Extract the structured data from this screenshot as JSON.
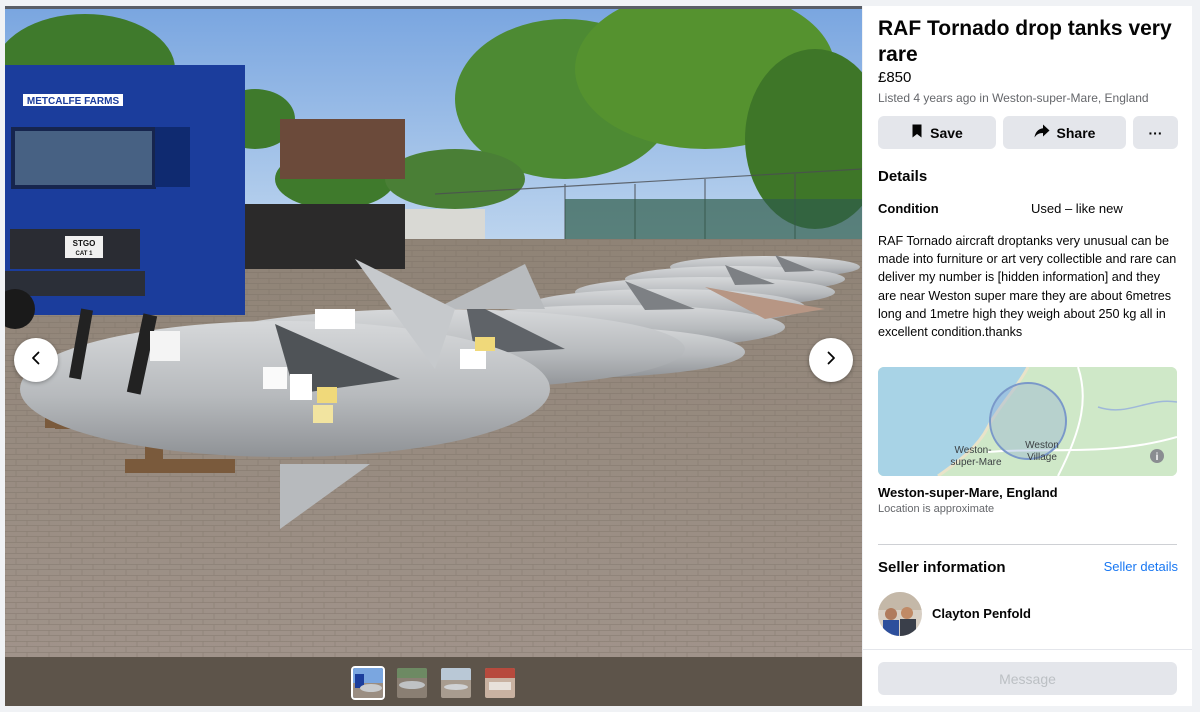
{
  "listing": {
    "title": "RAF Tornado drop tanks very rare",
    "price": "£850",
    "listed": "Listed 4 years ago in Weston-super-Mare, England"
  },
  "actions": {
    "save_label": "Save",
    "share_label": "Share",
    "more_label": "···"
  },
  "details": {
    "heading": "Details",
    "condition_label": "Condition",
    "condition_value": "Used – like new",
    "description": "RAF Tornado aircraft droptanks very unusual can be made into furniture or art very collectible and rare can deliver my number is [hidden information] and they are near Weston super mare they are about 6metres long and 1metre high they weigh about 250 kg all in excellent condition.thanks"
  },
  "map": {
    "label_1": "Weston-",
    "label_2": "super-Mare",
    "label_3": "Weston",
    "label_4": "Village",
    "info_icon": "info-icon"
  },
  "location": {
    "name": "Weston-super-Mare, England",
    "note": "Location is approximate"
  },
  "seller": {
    "heading": "Seller information",
    "details_link": "Seller details",
    "name": "Clayton Penfold"
  },
  "message_label": "Message",
  "photo": {
    "truck_sign": "METCALFE FARMS",
    "plate_1": "STGO",
    "plate_2": "CAT 1",
    "icons": {
      "prev": "chevron-left-icon",
      "next": "chevron-right-icon"
    }
  },
  "thumbnails_count_visible": 4,
  "colors": {
    "accent": "#1877f2",
    "button_bg": "#e4e6eb",
    "secondary_text": "#65676b"
  }
}
